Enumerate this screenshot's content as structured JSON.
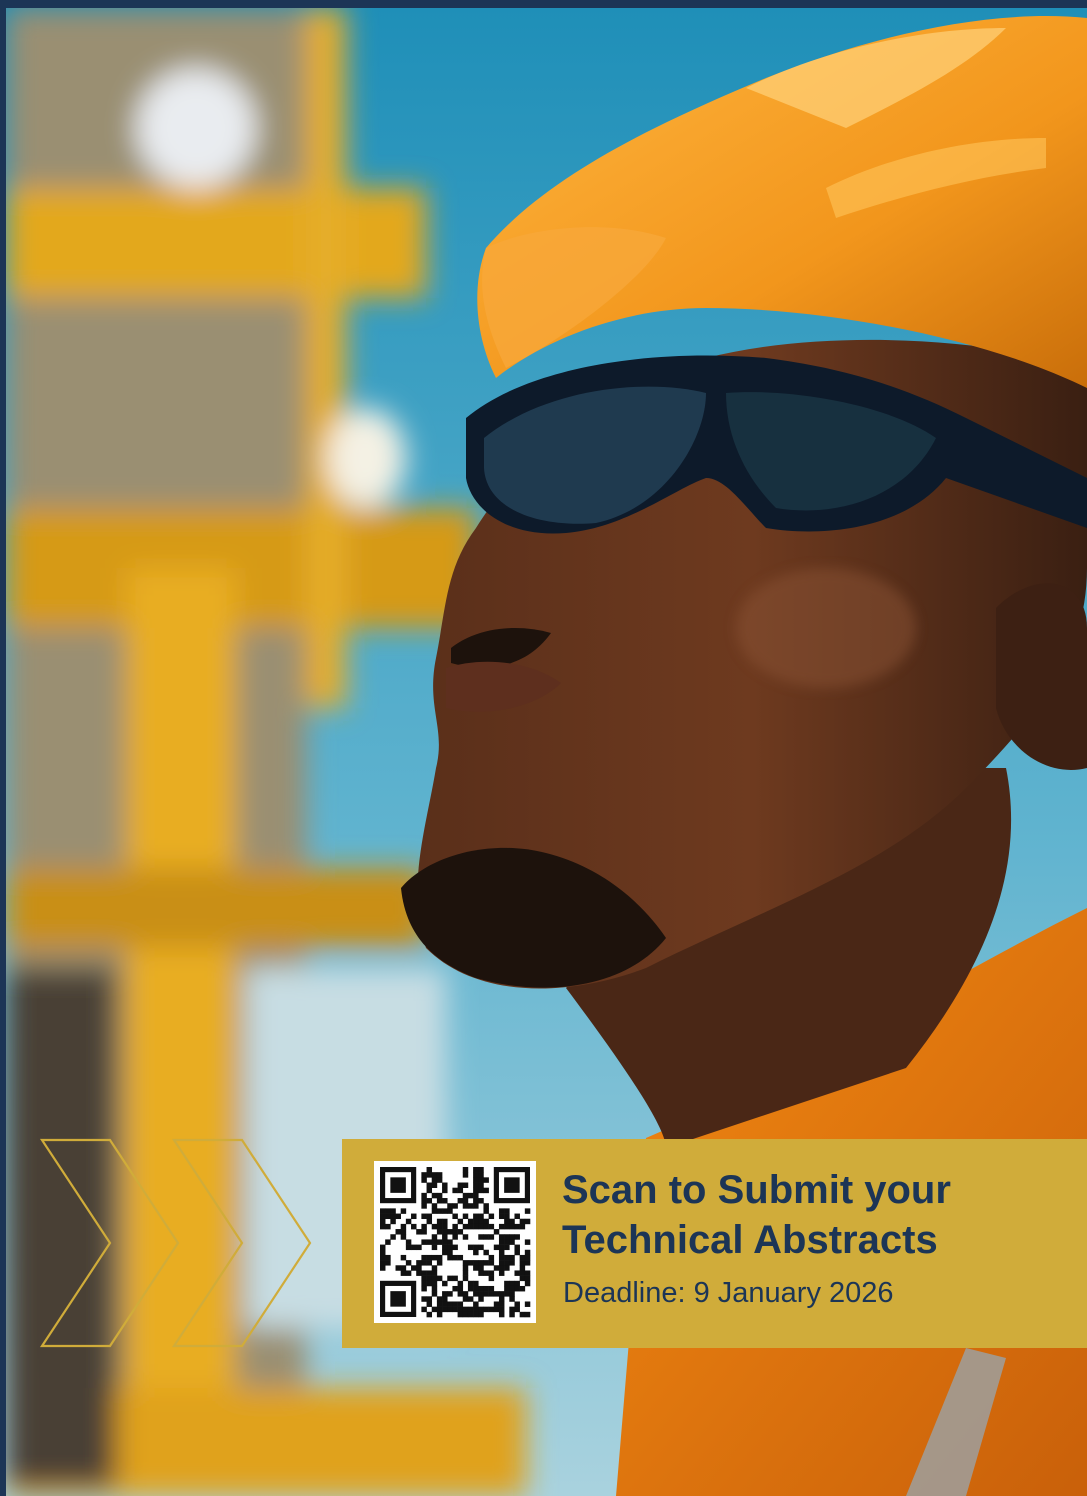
{
  "cta": {
    "title_line1": "Scan to Submit your",
    "title_line2": "Technical Abstracts",
    "deadline": "Deadline: 9 January 2026"
  },
  "colors": {
    "navy": "#1c3556",
    "gold": "#d0ac3a",
    "helmet_orange": "#f29a1c"
  },
  "icons": {
    "chevrons": "double-chevron-right-outline-icon",
    "qr": "qr-code-icon"
  }
}
